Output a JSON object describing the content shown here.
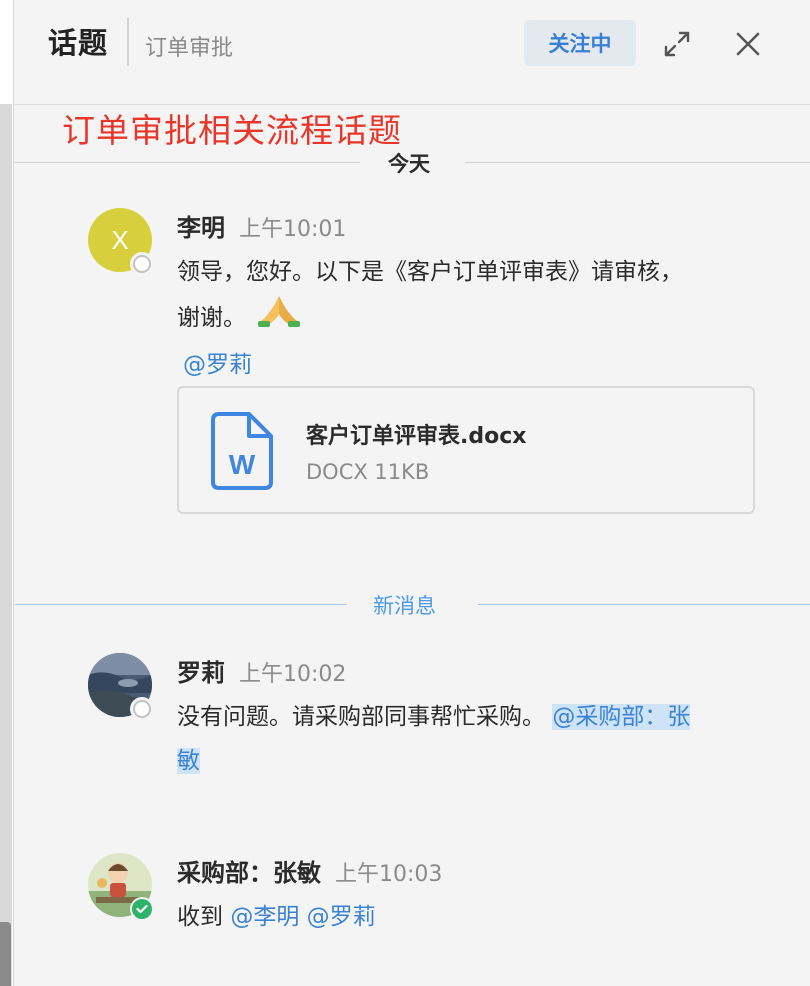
{
  "header": {
    "title": "话题",
    "subtitle": "订单审批",
    "follow_label": "关注中"
  },
  "annotation": "订单审批相关流程话题",
  "dividers": {
    "today": "今天",
    "new_messages": "新消息"
  },
  "messages": [
    {
      "sender": "李明",
      "time": "上午10:01",
      "avatar_letter": "X",
      "avatar_color": "#d7cf3c",
      "status": "offline",
      "text_line1": "领导，您好。以下是《客户订单评审表》请审核，",
      "text_line2": "谢谢。",
      "emoji": "praying-hands-icon",
      "mention": "@罗莉",
      "attachment": {
        "name": "客户订单评审表.docx",
        "meta": "DOCX 11KB",
        "icon": "word-file-icon"
      }
    },
    {
      "sender": "罗莉",
      "time": "上午10:02",
      "status": "offline",
      "text": "没有问题。请采购部同事帮忙采购。",
      "mention_part1": "@采购部：张",
      "mention_part2": "敏"
    },
    {
      "sender": "采购部：张敏",
      "time": "上午10:03",
      "status": "online",
      "text": "收到",
      "mentions": [
        "@李明",
        "@罗莉"
      ]
    }
  ],
  "colors": {
    "accent_blue": "#3a83d4",
    "annotation_red": "#e8372a",
    "online_green": "#2fb36b"
  }
}
